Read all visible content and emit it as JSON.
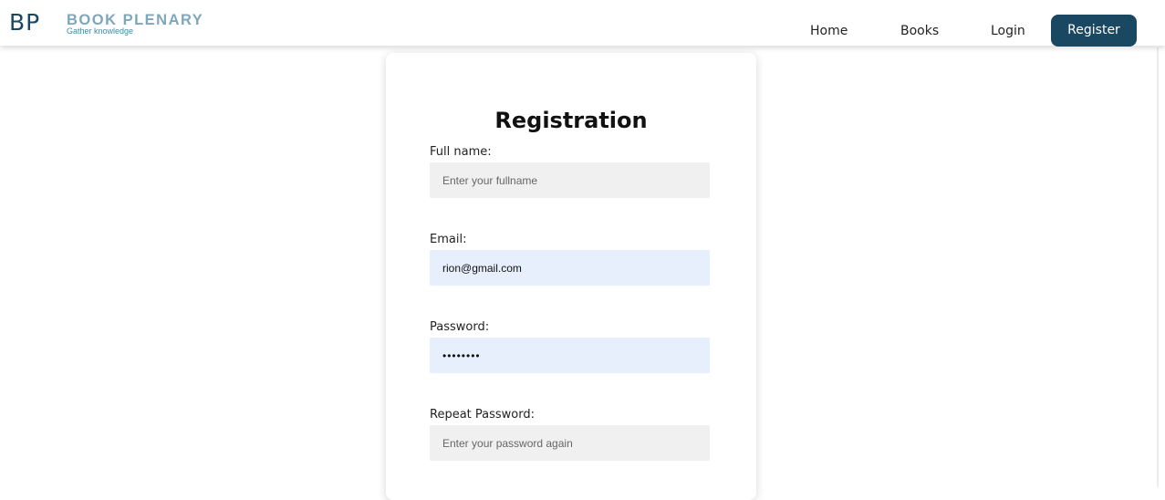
{
  "brand": {
    "mark": "BP",
    "name": "BOOK PLENARY",
    "tagline": "Gather knowledge"
  },
  "nav": {
    "home": "Home",
    "books": "Books",
    "login": "Login",
    "register": "Register"
  },
  "form": {
    "title": "Registration",
    "fullname": {
      "label": "Full name:",
      "value": "",
      "placeholder": "Enter your fullname"
    },
    "email": {
      "label": "Email:",
      "value": "rion@gmail.com",
      "placeholder": ""
    },
    "password": {
      "label": "Password:",
      "value": "••••••••",
      "placeholder": ""
    },
    "repeat_password": {
      "label": "Repeat Password:",
      "value": "",
      "placeholder": "Enter your password again"
    }
  },
  "colors": {
    "primary": "#1a4862",
    "brand_text": "#7ea7bb",
    "tagline": "#3e8aa7",
    "input_empty": "#f0f0f0",
    "input_filled": "#e8effc"
  }
}
